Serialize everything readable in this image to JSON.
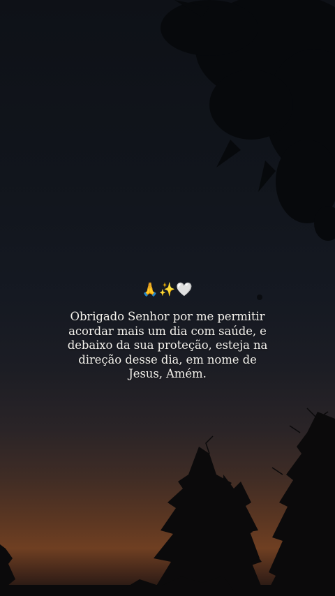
{
  "emoji": {
    "pray": "🙏",
    "sparkles": "✨",
    "heart": "🤍"
  },
  "message": "Obrigado Senhor por me permitir\nacordar mais um dia com saúde, e\ndebaixo da sua proteção, esteja na\ndireção desse dia, em nome de\nJesus, Amém."
}
